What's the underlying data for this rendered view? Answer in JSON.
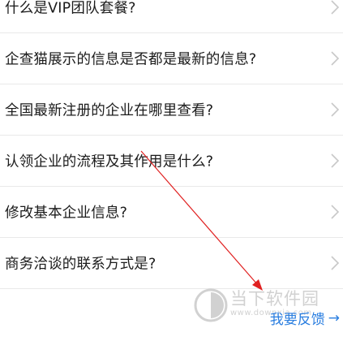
{
  "faq": {
    "items": [
      {
        "label": "什么是VIP团队套餐?"
      },
      {
        "label": "企查猫展示的信息是否都是最新的信息?"
      },
      {
        "label": "全国最新注册的企业在哪里查看?"
      },
      {
        "label": "认领企业的流程及其作用是什么?"
      },
      {
        "label": "修改基本企业信息?"
      },
      {
        "label": "商务洽谈的联系方式是?"
      }
    ]
  },
  "footer": {
    "feedback_label": "我要反馈",
    "feedback_arrow": "→"
  },
  "watermark": {
    "title": "当下软件园",
    "subtitle": "www.downxia.com"
  },
  "colors": {
    "link": "#2a7ee0",
    "annotation_arrow": "#e02020",
    "divider": "#e9e9e9"
  },
  "icons": {
    "row_chevron": "chevron-right-icon",
    "annotation": "red-arrow-icon"
  }
}
